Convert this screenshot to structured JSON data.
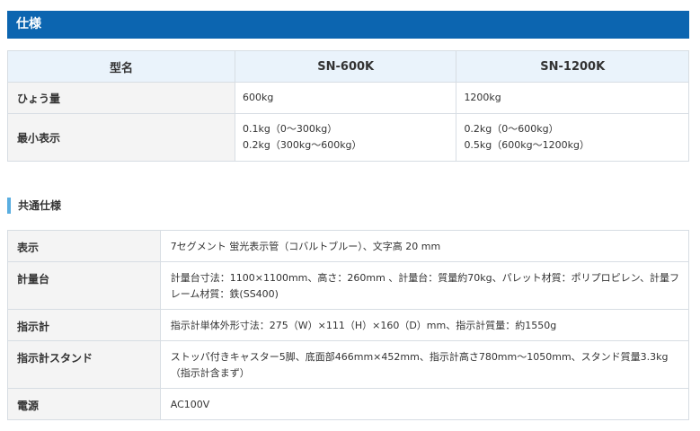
{
  "header": {
    "title": "仕様"
  },
  "spec": {
    "headers": [
      "型名",
      "SN-600K",
      "SN-1200K"
    ],
    "rows": [
      {
        "label": "ひょう量",
        "v1": [
          "600kg"
        ],
        "v2": [
          "1200kg"
        ]
      },
      {
        "label": "最小表示",
        "v1": [
          "0.1kg（0〜300kg）",
          "0.2kg（300kg〜600kg）"
        ],
        "v2": [
          "0.2kg（0〜600kg）",
          "0.5kg（600kg〜1200kg）"
        ]
      }
    ]
  },
  "common": {
    "title": "共通仕様",
    "rows": [
      {
        "label": "表示",
        "lines": [
          "7セグメント 蛍光表示管（コバルトブルー）、文字高 20 mm"
        ]
      },
      {
        "label": "計量台",
        "lines": [
          "計量台寸法：1100×1100mm、高さ：260mm 、計量台：質量約70kg、パレット材質：ポリプロピレン、計量フ",
          "レーム材質：鉄(SS400)"
        ]
      },
      {
        "label": "指示計",
        "lines": [
          "指示計単体外形寸法：275（W）×111（H）×160（D）mm、指示計質量：約1550g"
        ]
      },
      {
        "label": "指示計スタンド",
        "lines": [
          "ストッパ付きキャスター5脚、底面部466mm×452mm、指示計高さ780mm〜1050mm、スタンド質量3.3kg",
          "（指示計含まず）"
        ]
      },
      {
        "label": "電源",
        "lines": [
          "AC100V"
        ]
      }
    ]
  },
  "colors": {
    "header_bg": "#0c65b0",
    "th_bg": "#eaf3fb",
    "label_bg": "#f4f4f4",
    "accent": "#5aaee0"
  }
}
